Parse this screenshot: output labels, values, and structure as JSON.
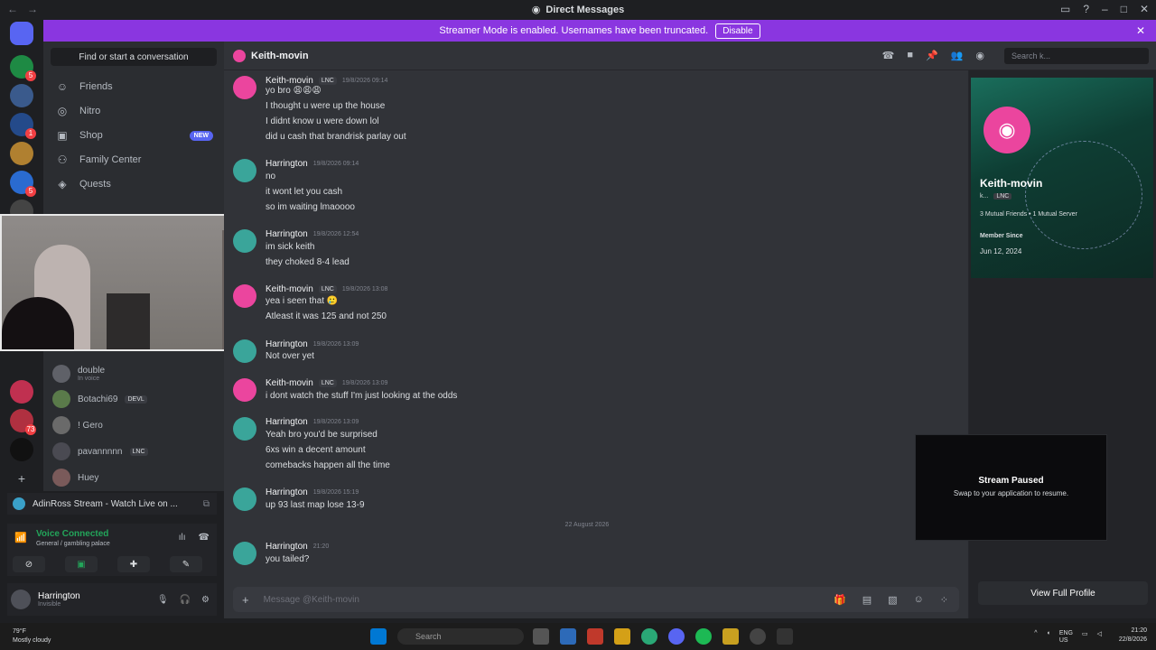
{
  "window": {
    "title": "Direct Messages"
  },
  "banner": {
    "text": "Streamer Mode is enabled. Usernames have been truncated.",
    "disable_label": "Disable"
  },
  "sidebar": {
    "find_placeholder": "Find or start a conversation",
    "nav": [
      {
        "label": "Friends",
        "icon": "friends-icon"
      },
      {
        "label": "Nitro",
        "icon": "nitro-icon"
      },
      {
        "label": "Shop",
        "icon": "shop-icon",
        "badge": "NEW"
      },
      {
        "label": "Family Center",
        "icon": "family-icon"
      },
      {
        "label": "Quests",
        "icon": "quests-icon"
      }
    ],
    "dms": [
      {
        "name": "double",
        "sub": "In voice"
      },
      {
        "name": "Botachi69",
        "tag": "DEVL"
      },
      {
        "name": "! Gero"
      },
      {
        "name": "pavannnnn",
        "tag": "LNC"
      },
      {
        "name": "Huey"
      }
    ],
    "stream": "AdinRoss Stream - Watch Live on ...",
    "voice": {
      "status": "Voice Connected",
      "channel": "General / gambling palace"
    },
    "user": {
      "name": "Harrington",
      "status": "Invisible"
    }
  },
  "chat": {
    "header_name": "Keith-movin",
    "search_placeholder": "Search k...",
    "composer_placeholder": "Message @Keith-movin",
    "date_divider": "22 August 2026",
    "messages": [
      {
        "author": "Keith-movin",
        "tag": "LNC",
        "time": "19/8/2026 09:14",
        "lines": [
          "yo bro 😩😩😩",
          "I thought u were up the house",
          "I didnt know u were down lol",
          "did u cash that brandrisk parlay out"
        ]
      },
      {
        "author": "Harrington",
        "time": "19/8/2026 09:14",
        "lines": [
          "no",
          "it wont let you cash",
          "so im waiting lmaoooo"
        ]
      },
      {
        "author": "Harrington",
        "time": "19/8/2026 12:54",
        "lines": [
          "im sick keith",
          "they choked 8-4 lead"
        ]
      },
      {
        "author": "Keith-movin",
        "tag": "LNC",
        "time": "19/8/2026 13:08",
        "lines": [
          "yea i seen that 🥲",
          "Atleast it was 125 and not 250"
        ]
      },
      {
        "author": "Harrington",
        "time": "19/8/2026 13:09",
        "lines": [
          "Not over yet"
        ]
      },
      {
        "author": "Keith-movin",
        "tag": "LNC",
        "time": "19/8/2026 13:09",
        "lines": [
          "i dont watch the stuff I'm just looking at the odds"
        ]
      },
      {
        "author": "Harrington",
        "time": "19/8/2026 13:09",
        "lines": [
          "Yeah bro you'd be surprised",
          "6xs win a decent amount",
          "comebacks happen all the time"
        ]
      },
      {
        "author": "Harrington",
        "time": "19/8/2026 15:19",
        "lines": [
          "up 93 last map lose 13-9"
        ]
      },
      {
        "author": "Harrington",
        "time": "21:20",
        "lines": [
          "you tailed?"
        ]
      }
    ]
  },
  "profile": {
    "name": "Keith-movin",
    "handle": "k...",
    "tag": "LNC",
    "mutual": "3 Mutual Friends • 1 Mutual Server",
    "member_since_label": "Member Since",
    "member_since": "Jun 12, 2024",
    "full_profile_label": "View Full Profile"
  },
  "overlay": {
    "title": "Stream Paused",
    "subtitle": "Swap to your application to resume."
  },
  "taskbar": {
    "temp": "79°F",
    "weather": "Mostly cloudy",
    "search": "Search",
    "lang": "ENG",
    "region": "US",
    "time": "21:20",
    "date": "22/8/2026"
  }
}
